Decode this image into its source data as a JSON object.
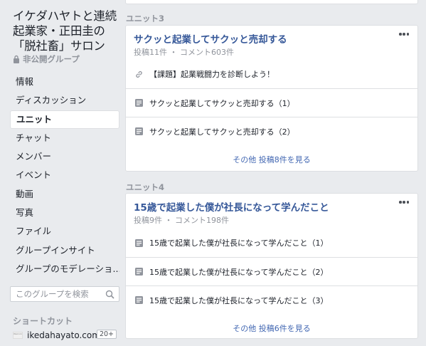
{
  "group": {
    "title": "イケダハヤトと連続起業家・正田圭の「脱社畜」サロン",
    "privacy": "非公開グループ"
  },
  "nav": [
    {
      "label": "情報",
      "active": false
    },
    {
      "label": "ディスカッション",
      "active": false
    },
    {
      "label": "ユニット",
      "active": true
    },
    {
      "label": "チャット",
      "active": false
    },
    {
      "label": "メンバー",
      "active": false
    },
    {
      "label": "イベント",
      "active": false
    },
    {
      "label": "動画",
      "active": false
    },
    {
      "label": "写真",
      "active": false
    },
    {
      "label": "ファイル",
      "active": false
    },
    {
      "label": "グループインサイト",
      "active": false
    },
    {
      "label": "グループのモデレーショ...",
      "active": false
    }
  ],
  "search": {
    "placeholder": "このグループを検索"
  },
  "shortcuts": {
    "heading": "ショートカット",
    "items": [
      {
        "name": "ikedahayato.com",
        "thumb_label": "Welcome",
        "count": "20+"
      }
    ]
  },
  "units": [
    {
      "section": "ユニット3",
      "title": "サクッと起業してサクッと売却する",
      "meta": "投稿11件 ・ コメント603件",
      "posts": [
        {
          "icon": "link-icon",
          "text": "【課題】起業戦闘力を診断しよう！"
        },
        {
          "icon": "post-icon",
          "text": "サクッと起業してサクッと売却する（1）"
        },
        {
          "icon": "post-icon",
          "text": "サクッと起業してサクッと売却する（2）"
        }
      ],
      "see_more": "その他 投稿8件を見る"
    },
    {
      "section": "ユニット4",
      "title": "15歳で起業した僕が社長になって学んだこと",
      "meta": "投稿9件 ・ コメント198件",
      "posts": [
        {
          "icon": "post-icon",
          "text": "15歳で起業した僕が社長になって学んだこと（1）"
        },
        {
          "icon": "post-icon",
          "text": "15歳で起業した僕が社長になって学んだこと（2）"
        },
        {
          "icon": "post-icon",
          "text": "15歳で起業した僕が社長になって学んだこと（3）"
        }
      ],
      "see_more": "その他 投稿6件を見る"
    }
  ]
}
